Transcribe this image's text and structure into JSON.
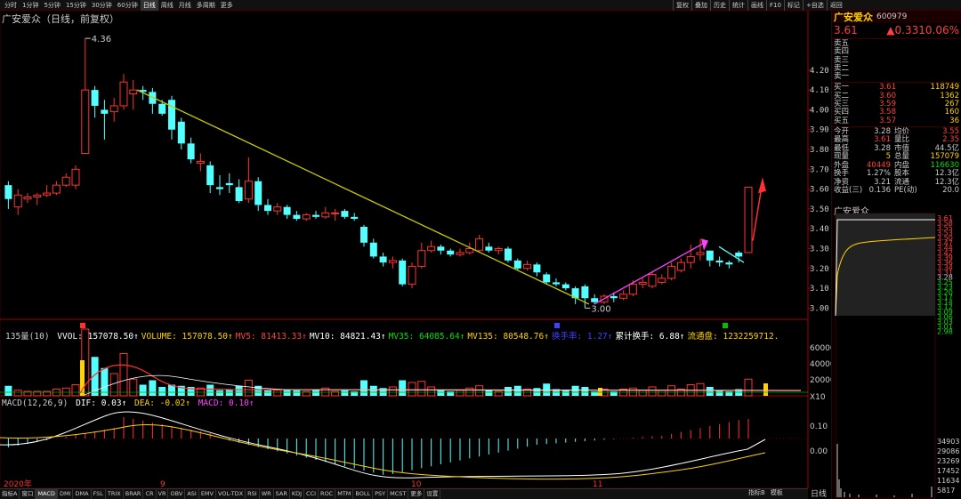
{
  "toolbar": {
    "periods": [
      "分时",
      "1分钟",
      "5分钟",
      "15分钟",
      "30分钟",
      "60分钟",
      "日线",
      "周线",
      "月线",
      "多周期",
      "更多"
    ],
    "active_period": 6,
    "tools": [
      "复权",
      "叠加",
      "历史",
      "统计",
      "画线",
      "F10",
      "标记",
      "+自选",
      "返回"
    ]
  },
  "chart": {
    "title": "广安爱众（日线，前复权）",
    "high_label": "4.36",
    "low_label": "3.00",
    "price_ticks": [
      "4.20",
      "4.10",
      "4.00",
      "3.90",
      "3.80",
      "3.70",
      "3.60",
      "3.50",
      "3.40",
      "3.30",
      "3.20",
      "3.10",
      "3.00"
    ],
    "date_labels": [
      "2020年",
      "9",
      "10",
      "11"
    ]
  },
  "volume": {
    "label": "135量(10)",
    "items": [
      {
        "text": "VVOL: 157078.50↑",
        "color": "#ffffff"
      },
      {
        "text": "VOLUME: 157078.50↑",
        "color": "#ffd200"
      },
      {
        "text": "MV5: 81413.33↑",
        "color": "#ff4040"
      },
      {
        "text": "MV10: 84821.43↑",
        "color": "#ffffff"
      },
      {
        "text": "MV35: 64085.64↑",
        "color": "#00e000"
      },
      {
        "text": "MV135: 80548.76↑",
        "color": "#ffd200"
      },
      {
        "text": "换手率: 1.27↑",
        "color": "#4040ff"
      },
      {
        "text": "累计换手: 6.88↑",
        "color": "#ffffff"
      },
      {
        "text": "流通盘: 1232259712.",
        "color": "#ffd200"
      }
    ],
    "ticks": [
      "60000",
      "40000",
      "20000",
      "X10"
    ]
  },
  "macd": {
    "label": "MACD(12,26,9)",
    "dif": "DIF: 0.03↑",
    "dea": "DEA: -0.02↑",
    "macd": "MACD: 0.10↑",
    "ticks": [
      "0.10",
      "0.00"
    ]
  },
  "bottom_tabs": [
    "指标A",
    "窗口",
    "MACD",
    "DMI",
    "DMA",
    "FSL",
    "TRIX",
    "BRAR",
    "CR",
    "VR",
    "OBV",
    "ASI",
    "EMV",
    "VOL-TDX",
    "RSI",
    "WR",
    "SAR",
    "KDJ",
    "CCI",
    "ROC",
    "MTM",
    "BOLL",
    "PSY",
    "MCST",
    "更多",
    "设置"
  ],
  "bottom_tab_active": 2,
  "bottom_right": [
    "指标B",
    "模板"
  ],
  "panel": {
    "name": "广安爱众",
    "code": "600979",
    "price": "3.61",
    "change": "▲0.33",
    "pct": "10.06%",
    "asks": [
      {
        "label": "卖五",
        "price": "",
        "vol": ""
      },
      {
        "label": "卖四",
        "price": "",
        "vol": ""
      },
      {
        "label": "卖三",
        "price": "",
        "vol": ""
      },
      {
        "label": "卖二",
        "price": "",
        "vol": ""
      },
      {
        "label": "卖一",
        "price": "",
        "vol": ""
      }
    ],
    "bids": [
      {
        "label": "买一",
        "price": "3.61",
        "vol": "118749"
      },
      {
        "label": "买二",
        "price": "3.60",
        "vol": "1362"
      },
      {
        "label": "买三",
        "price": "3.59",
        "vol": "267"
      },
      {
        "label": "买四",
        "price": "3.58",
        "vol": "160"
      },
      {
        "label": "买五",
        "price": "3.57",
        "vol": "36"
      }
    ],
    "stats": [
      {
        "k": "今开",
        "v": "3.28",
        "vc": "#ccc",
        "k2": "均价",
        "v2": "3.55",
        "v2c": "#ff4040"
      },
      {
        "k": "最高",
        "v": "3.61",
        "vc": "#ff4040",
        "k2": "量比",
        "v2": "2.35",
        "v2c": "#ff4040"
      },
      {
        "k": "最低",
        "v": "3.28",
        "vc": "#ccc",
        "k2": "市值",
        "v2": "44.5亿",
        "v2c": "#ccc"
      },
      {
        "k": "现量",
        "v": "5",
        "vc": "#ffd200",
        "k2": "总量",
        "v2": "157079",
        "v2c": "#ffd200"
      },
      {
        "k": "外盘",
        "v": "40449",
        "vc": "#ff4040",
        "k2": "内盘",
        "v2": "116630",
        "v2c": "#00e000"
      },
      {
        "k": "换手",
        "v": "1.27%",
        "vc": "#ccc",
        "k2": "股本",
        "v2": "12.3亿",
        "v2c": "#ccc"
      },
      {
        "k": "净资",
        "v": "3.21",
        "vc": "#ccc",
        "k2": "流通",
        "v2": "12.3亿",
        "v2c": "#ccc"
      },
      {
        "k": "收益(三)",
        "v": "0.136",
        "vc": "#ccc",
        "k2": "PE(动)",
        "v2": "20.0",
        "v2c": "#ccc"
      }
    ],
    "mini_title": "广安爱众",
    "mini_ticks": [
      "3.61",
      "3.58",
      "3.55",
      "3.53",
      "3.50",
      "3.47",
      "3.44",
      "3.42",
      "3.39",
      "3.36",
      "3.34",
      "3.31",
      "3.28",
      "3.25",
      "3.23",
      "3.20",
      "3.17",
      "3.14",
      "3.12",
      "3.09",
      "3.06",
      "3.03",
      "3.01",
      "2.98"
    ],
    "mini_vol_ticks": [
      "34903",
      "29086",
      "23269",
      "17452",
      "11634",
      "5817"
    ],
    "footer": "日线"
  },
  "candles": [
    [
      3.62,
      3.55,
      3.64,
      3.5
    ],
    [
      3.51,
      3.57,
      3.6,
      3.47
    ],
    [
      3.55,
      3.56,
      3.58,
      3.53
    ],
    [
      3.56,
      3.57,
      3.58,
      3.52
    ],
    [
      3.57,
      3.58,
      3.62,
      3.56
    ],
    [
      3.58,
      3.62,
      3.64,
      3.57
    ],
    [
      3.62,
      3.66,
      3.68,
      3.61
    ],
    [
      3.62,
      3.7,
      3.72,
      3.6
    ],
    [
      3.78,
      4.1,
      4.36,
      3.78
    ],
    [
      4.1,
      4.02,
      4.12,
      3.96
    ],
    [
      4.0,
      3.98,
      4.05,
      3.85
    ],
    [
      3.99,
      4.02,
      4.06,
      3.94
    ],
    [
      4.02,
      4.14,
      4.18,
      4.0
    ],
    [
      4.08,
      4.1,
      4.15,
      4.0
    ],
    [
      4.1,
      4.09,
      4.12,
      4.05
    ],
    [
      4.09,
      4.03,
      4.11,
      3.98
    ],
    [
      4.03,
      3.98,
      4.05,
      3.97
    ],
    [
      4.05,
      3.9,
      4.07,
      3.85
    ],
    [
      3.94,
      3.83,
      3.96,
      3.8
    ],
    [
      3.83,
      3.75,
      3.86,
      3.73
    ],
    [
      3.73,
      3.74,
      3.78,
      3.69
    ],
    [
      3.72,
      3.62,
      3.74,
      3.58
    ],
    [
      3.61,
      3.6,
      3.67,
      3.57
    ],
    [
      3.63,
      3.62,
      3.68,
      3.58
    ],
    [
      3.61,
      3.54,
      3.65,
      3.53
    ],
    [
      3.55,
      3.64,
      3.76,
      3.53
    ],
    [
      3.64,
      3.52,
      3.66,
      3.49
    ],
    [
      3.52,
      3.49,
      3.55,
      3.47
    ],
    [
      3.49,
      3.51,
      3.53,
      3.47
    ],
    [
      3.51,
      3.47,
      3.52,
      3.45
    ],
    [
      3.47,
      3.45,
      3.49,
      3.44
    ],
    [
      3.45,
      3.47,
      3.48,
      3.44
    ],
    [
      3.47,
      3.46,
      3.49,
      3.45
    ],
    [
      3.46,
      3.48,
      3.51,
      3.45
    ],
    [
      3.48,
      3.48,
      3.5,
      3.44
    ],
    [
      3.49,
      3.46,
      3.5,
      3.45
    ],
    [
      3.46,
      3.45,
      3.48,
      3.44
    ],
    [
      3.41,
      3.33,
      3.42,
      3.31
    ],
    [
      3.33,
      3.26,
      3.35,
      3.25
    ],
    [
      3.26,
      3.23,
      3.28,
      3.21
    ],
    [
      3.23,
      3.24,
      3.26,
      3.2
    ],
    [
      3.24,
      3.12,
      3.25,
      3.11
    ],
    [
      3.12,
      3.21,
      3.23,
      3.1
    ],
    [
      3.21,
      3.29,
      3.33,
      3.2
    ],
    [
      3.29,
      3.31,
      3.34,
      3.28
    ],
    [
      3.31,
      3.29,
      3.32,
      3.27
    ],
    [
      3.29,
      3.27,
      3.3,
      3.26
    ],
    [
      3.27,
      3.28,
      3.3,
      3.26
    ],
    [
      3.28,
      3.3,
      3.33,
      3.27
    ],
    [
      3.29,
      3.35,
      3.37,
      3.28
    ],
    [
      3.31,
      3.29,
      3.33,
      3.28
    ],
    [
      3.29,
      3.3,
      3.31,
      3.27
    ],
    [
      3.3,
      3.24,
      3.31,
      3.23
    ],
    [
      3.24,
      3.2,
      3.25,
      3.19
    ],
    [
      3.2,
      3.22,
      3.24,
      3.19
    ],
    [
      3.22,
      3.18,
      3.23,
      3.16
    ],
    [
      3.17,
      3.13,
      3.18,
      3.12
    ],
    [
      3.13,
      3.12,
      3.15,
      3.11
    ],
    [
      3.12,
      3.1,
      3.13,
      3.09
    ],
    [
      3.1,
      3.05,
      3.11,
      3.02
    ],
    [
      3.11,
      3.05,
      3.12,
      3.0
    ],
    [
      3.05,
      3.03,
      3.07,
      3.02
    ],
    [
      3.03,
      3.06,
      3.07,
      3.02
    ],
    [
      3.06,
      3.05,
      3.08,
      3.03
    ],
    [
      3.05,
      3.07,
      3.09,
      3.04
    ],
    [
      3.07,
      3.12,
      3.14,
      3.06
    ],
    [
      3.12,
      3.13,
      3.15,
      3.1
    ],
    [
      3.11,
      3.17,
      3.18,
      3.1
    ],
    [
      3.13,
      3.15,
      3.17,
      3.12
    ],
    [
      3.15,
      3.21,
      3.23,
      3.14
    ],
    [
      3.19,
      3.23,
      3.25,
      3.18
    ],
    [
      3.23,
      3.26,
      3.32,
      3.2
    ],
    [
      3.27,
      3.28,
      3.35,
      3.24
    ],
    [
      3.29,
      3.24,
      3.29,
      3.21
    ],
    [
      3.24,
      3.23,
      3.26,
      3.21
    ],
    [
      3.23,
      3.22,
      3.24,
      3.2
    ],
    [
      3.28,
      3.26,
      3.29,
      3.23
    ],
    [
      3.28,
      3.61,
      3.61,
      3.28
    ]
  ],
  "vol_heights": [
    9,
    5,
    4,
    4,
    4,
    6,
    7,
    10,
    60,
    35,
    25,
    20,
    38,
    15,
    10,
    14,
    8,
    10,
    9,
    8,
    7,
    10,
    5,
    6,
    9,
    14,
    9,
    5,
    5,
    6,
    5,
    4,
    6,
    7,
    4,
    5,
    4,
    14,
    9,
    7,
    8,
    14,
    12,
    13,
    8,
    5,
    4,
    5,
    7,
    9,
    5,
    4,
    8,
    9,
    6,
    7,
    11,
    6,
    5,
    9,
    8,
    4,
    6,
    4,
    6,
    7,
    5,
    8,
    5,
    9,
    6,
    10,
    11,
    8,
    5,
    4,
    6,
    15
  ]
}
